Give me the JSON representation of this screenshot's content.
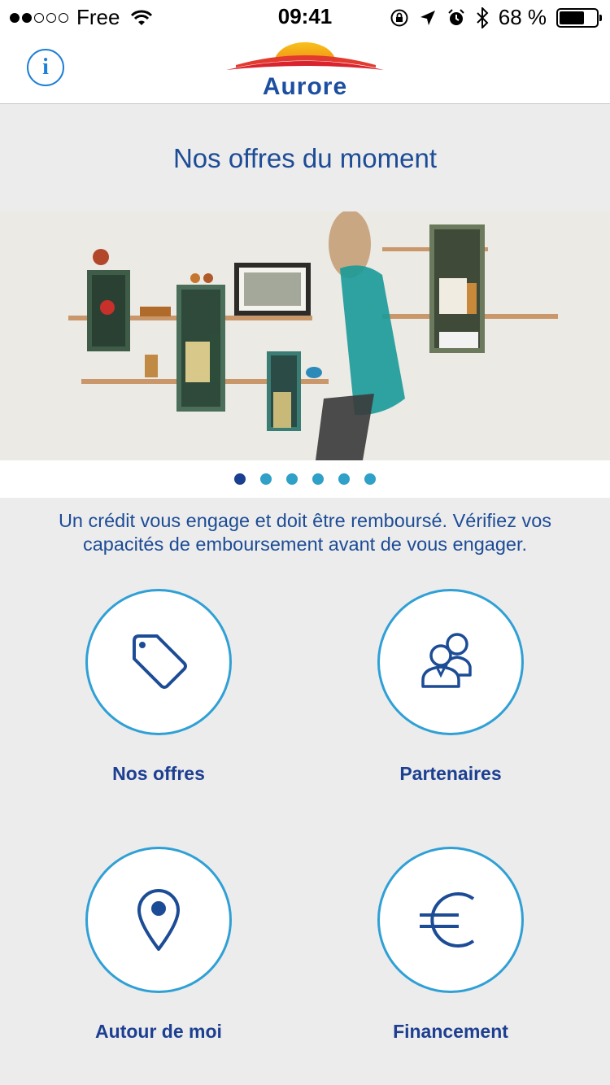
{
  "status_bar": {
    "carrier": "Free",
    "time": "09:41",
    "battery_percent": "68 %",
    "battery_level": 0.68
  },
  "nav": {
    "logo_text": "Aurore"
  },
  "offers": {
    "title": "Nos offres du moment"
  },
  "carousel": {
    "count": 6,
    "active_index": 0
  },
  "disclaimer": {
    "line1": "Un crédit vous engage et doit être remboursé. Vérifiez vos",
    "line2": "capacités de emboursement avant de vous engager."
  },
  "tiles": [
    {
      "label": "Nos offres",
      "icon": "tag-icon"
    },
    {
      "label": "Partenaires",
      "icon": "partners-icon"
    },
    {
      "label": "Autour de moi",
      "icon": "location-pin-icon"
    },
    {
      "label": "Financement",
      "icon": "euro-icon"
    }
  ],
  "colors": {
    "brand_blue": "#1d4c96",
    "accent_light_blue": "#2fa0d6",
    "info_blue": "#1e7fd6",
    "background": "#ececec"
  }
}
